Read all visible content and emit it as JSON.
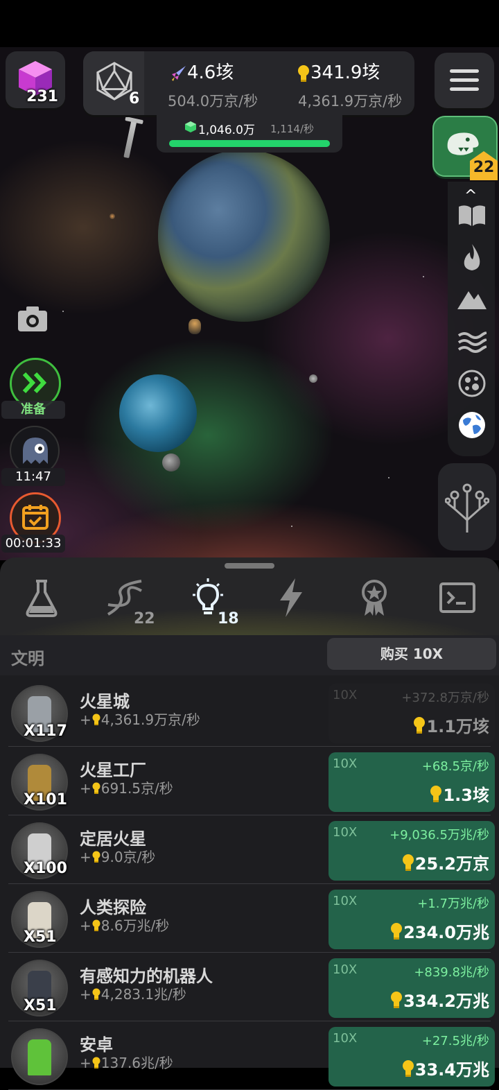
{
  "top": {
    "cube_count": "231",
    "dice_count": "6",
    "res_a_value": "4.6垓",
    "res_a_rate": "504.0万京/秒",
    "res_b_value": "341.9垓",
    "res_b_rate": "4,361.9万京/秒",
    "sub_value": "1,046.0万",
    "sub_rate": "1,114/秒",
    "sub_progress": 1.0,
    "dino_badge": "22"
  },
  "left": {
    "ready_label": "准备",
    "timer_label": "11:47",
    "event_timer": "00:01:33"
  },
  "side_icons": [
    "book-icon",
    "fire-icon",
    "mountain-icon",
    "waves-icon",
    "cell-icon",
    "globe-icon"
  ],
  "tabs": [
    {
      "icon": "flask-icon",
      "badge": ""
    },
    {
      "icon": "dna-icon",
      "badge": "22"
    },
    {
      "icon": "lightbulb-icon",
      "badge": "18"
    },
    {
      "icon": "lightning-icon",
      "badge": ""
    },
    {
      "icon": "award-icon",
      "badge": ""
    },
    {
      "icon": "terminal-icon",
      "badge": ""
    }
  ],
  "list": {
    "title": "文明",
    "buy_label": "购买 10X",
    "rows": [
      {
        "name": "火星城",
        "count": "X117",
        "rate": "+",
        "rate_val": "4,361.9万京/秒",
        "buy_x": "10X",
        "gain": "+372.8万京/秒",
        "cost": "1.1万垓",
        "enabled": false,
        "color": "#9aa0a6"
      },
      {
        "name": "火星工厂",
        "count": "X101",
        "rate": "+",
        "rate_val": "691.5京/秒",
        "buy_x": "10X",
        "gain": "+68.5京/秒",
        "cost": "1.3垓",
        "enabled": true,
        "color": "#b08a3a"
      },
      {
        "name": "定居火星",
        "count": "X100",
        "rate": "+",
        "rate_val": "9.0京/秒",
        "buy_x": "10X",
        "gain": "+9,036.5万兆/秒",
        "cost": "25.2万京",
        "enabled": true,
        "color": "#cfcfcf"
      },
      {
        "name": "人类探险",
        "count": "X51",
        "rate": "+",
        "rate_val": "8.6万兆/秒",
        "buy_x": "10X",
        "gain": "+1.7万兆/秒",
        "cost": "234.0万兆",
        "enabled": true,
        "color": "#dcd6c8"
      },
      {
        "name": "有感知力的机器人",
        "count": "X51",
        "rate": "+",
        "rate_val": "4,283.1兆/秒",
        "buy_x": "10X",
        "gain": "+839.8兆/秒",
        "cost": "334.2万兆",
        "enabled": true,
        "color": "#3a3f4a"
      },
      {
        "name": "安卓",
        "count": "",
        "rate": "+",
        "rate_val": "137.6兆/秒",
        "buy_x": "10X",
        "gain": "+27.5兆/秒",
        "cost": "33.4万兆",
        "enabled": true,
        "color": "#5fc23a"
      }
    ]
  }
}
